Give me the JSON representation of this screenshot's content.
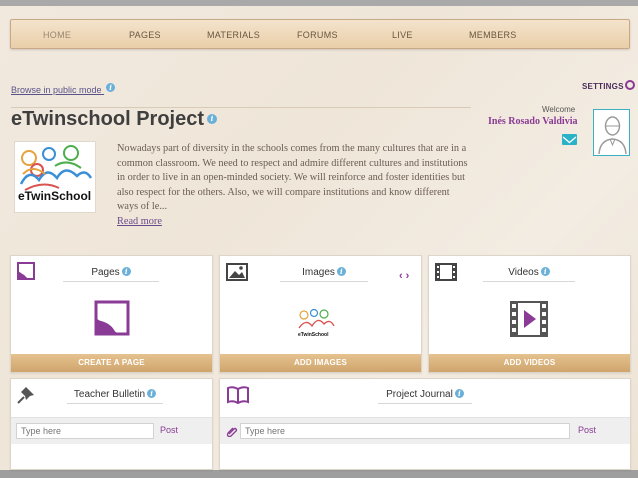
{
  "nav": {
    "items": [
      "HOME",
      "PAGES",
      "MATERIALS",
      "FORUMS",
      "LIVE",
      "MEMBERS"
    ]
  },
  "header": {
    "browse_link": "Browse in public mode",
    "settings_label": "SETTINGS",
    "title": "eTwinschool Project",
    "welcome_label": "Welcome",
    "user_name": "Inés Rosado Valdivia"
  },
  "project": {
    "logo_text": "eTwinSchool",
    "description": "Nowadays part of diversity in the schools comes from the many cultures that are in a common classroom. We need to respect and admire different cultures and institutions in order to live in an open-minded society. We will reinforce and foster identities but also respect for the others. Also, we will compare institutions and know different ways of le...",
    "read_more": "Read more"
  },
  "cards": {
    "pages": {
      "title": "Pages",
      "button": "CREATE A PAGE"
    },
    "images": {
      "title": "Images",
      "button": "ADD IMAGES",
      "thumb_text": "eTwinSchool"
    },
    "videos": {
      "title": "Videos",
      "button": "ADD VIDEOS"
    },
    "bulletin": {
      "title": "Teacher Bulletin",
      "placeholder": "Type here",
      "post": "Post"
    },
    "journal": {
      "title": "Project Journal",
      "placeholder": "Type here",
      "post": "Post"
    }
  },
  "carousel": {
    "prev": "‹",
    "next": "›"
  },
  "info_glyph": "i",
  "colors": {
    "accent": "#8a3b95",
    "teal": "#2bb2c7",
    "button": "#d8b07a"
  }
}
